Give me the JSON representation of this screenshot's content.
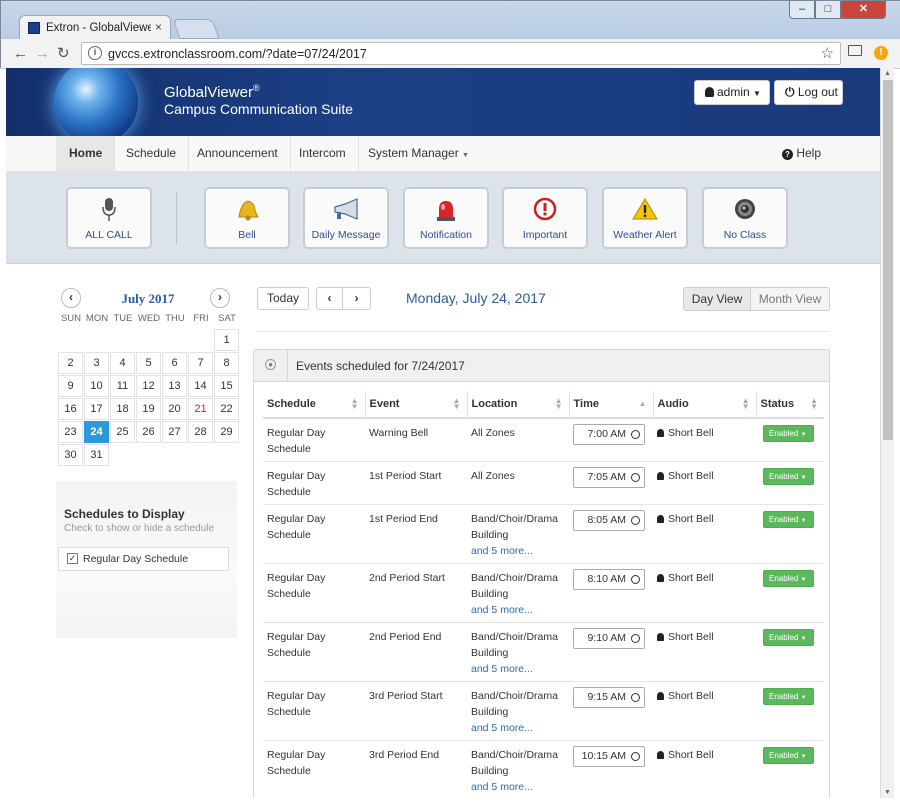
{
  "browser": {
    "tab_title": "Extron - GlobalViewer® C",
    "tab_close": "×",
    "url": "gvccs.extronclassroom.com/?date=07/24/2017",
    "win_min": "–",
    "win_max": "□",
    "win_close": "✕"
  },
  "header": {
    "brand_line1": "GlobalViewer",
    "brand_reg": "®",
    "brand_line2": "Campus Communication Suite",
    "admin_label": "admin",
    "logout_label": "Log out"
  },
  "nav": {
    "home": "Home",
    "schedule": "Schedule",
    "announcement": "Announcement",
    "intercom": "Intercom",
    "system_manager": "System Manager",
    "help": "Help"
  },
  "actions": {
    "allcall": "ALL CALL",
    "bell": "Bell",
    "daily": "Daily Message",
    "notification": "Notification",
    "important": "Important",
    "weather": "Weather Alert",
    "noclass": "No Class"
  },
  "calendar": {
    "month": "July 2017",
    "dow": [
      "SUN",
      "MON",
      "TUE",
      "WED",
      "THU",
      "FRI",
      "SAT"
    ],
    "today": "24",
    "highlight_red": "21",
    "weeks": [
      [
        "",
        "",
        "",
        "",
        "",
        "",
        "1"
      ],
      [
        "2",
        "3",
        "4",
        "5",
        "6",
        "7",
        "8"
      ],
      [
        "9",
        "10",
        "11",
        "12",
        "13",
        "14",
        "15"
      ],
      [
        "16",
        "17",
        "18",
        "19",
        "20",
        "21",
        "22"
      ],
      [
        "23",
        "24",
        "25",
        "26",
        "27",
        "28",
        "29"
      ],
      [
        "30",
        "31",
        "",
        "",
        "",
        "",
        ""
      ]
    ]
  },
  "schedules": {
    "title": "Schedules to Display",
    "subtitle": "Check to show or hide a schedule",
    "item": "Regular Day Schedule"
  },
  "toolbar": {
    "today": "Today",
    "date_title": "Monday, July 24, 2017",
    "day_view": "Day View",
    "month_view": "Month View"
  },
  "events": {
    "title": "Events scheduled for 7/24/2017",
    "columns": [
      "Schedule",
      "Event",
      "Location",
      "Time",
      "Audio",
      "Status"
    ],
    "rows": [
      {
        "schedule": "Regular Day Schedule",
        "event": "Warning Bell",
        "location": "All Zones",
        "more": "",
        "time": "7:00 AM",
        "audio": "Short Bell",
        "status": "Enabled"
      },
      {
        "schedule": "Regular Day Schedule",
        "event": "1st Period Start",
        "location": "All Zones",
        "more": "",
        "time": "7:05 AM",
        "audio": "Short Bell",
        "status": "Enabled"
      },
      {
        "schedule": "Regular Day Schedule",
        "event": "1st Period End",
        "location": "Band/Choir/Drama Building",
        "more": "and 5 more...",
        "time": "8:05 AM",
        "audio": "Short Bell",
        "status": "Enabled"
      },
      {
        "schedule": "Regular Day Schedule",
        "event": "2nd Period Start",
        "location": "Band/Choir/Drama Building",
        "more": "and 5 more...",
        "time": "8:10 AM",
        "audio": "Short Bell",
        "status": "Enabled"
      },
      {
        "schedule": "Regular Day Schedule",
        "event": "2nd Period End",
        "location": "Band/Choir/Drama Building",
        "more": "and 5 more...",
        "time": "9:10 AM",
        "audio": "Short Bell",
        "status": "Enabled"
      },
      {
        "schedule": "Regular Day Schedule",
        "event": "3rd Period Start",
        "location": "Band/Choir/Drama Building",
        "more": "and 5 more...",
        "time": "9:15 AM",
        "audio": "Short Bell",
        "status": "Enabled"
      },
      {
        "schedule": "Regular Day Schedule",
        "event": "3rd Period End",
        "location": "Band/Choir/Drama Building",
        "more": "and 5 more...",
        "time": "10:15 AM",
        "audio": "Short Bell",
        "status": "Enabled"
      }
    ]
  },
  "colors": {
    "banner": "#1c3f85",
    "accent_blue": "#2a9bd8",
    "enabled_green": "#5cb85c",
    "link": "#2b6ab0"
  },
  "icons": [
    "microphone-icon",
    "bell-icon",
    "megaphone-icon",
    "siren-icon",
    "exclamation-icon",
    "warning-icon",
    "speaker-icon",
    "user-icon",
    "power-icon",
    "help-icon",
    "clock-icon",
    "star-icon",
    "info-icon"
  ]
}
